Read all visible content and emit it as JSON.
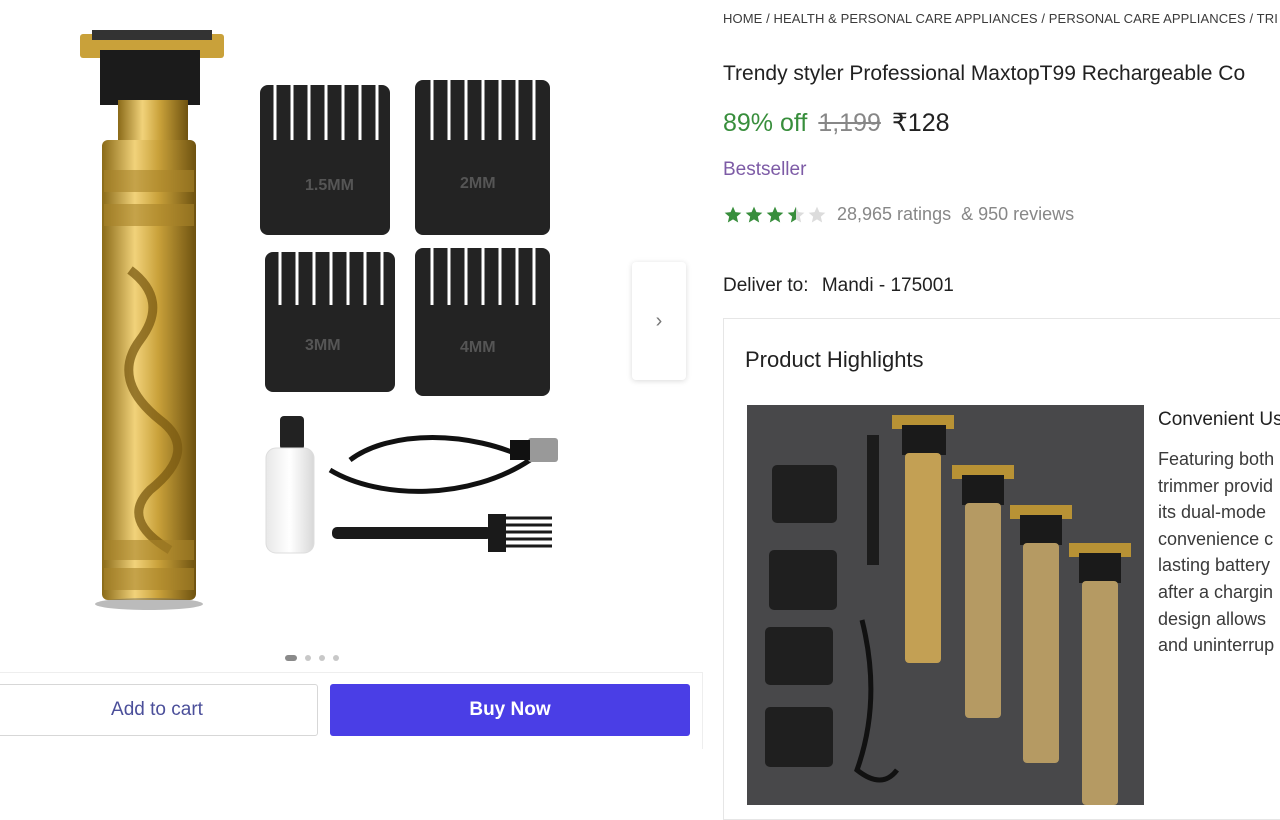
{
  "breadcrumb": "HOME / HEALTH & PERSONAL CARE APPLIANCES / PERSONAL CARE APPLIANCES / TRI",
  "product": {
    "title": "Trendy styler Professional MaxtopT99 Rechargeable Co",
    "discount": "89% off",
    "mrp": "1,199",
    "price": "₹128",
    "badge": "Bestseller",
    "rating": 3.5,
    "ratings_text": "28,965 ratings",
    "reviews_text": "& 950 reviews"
  },
  "delivery": {
    "label": "Deliver to:",
    "location": "Mandi - 175001"
  },
  "highlights": {
    "title": "Product Highlights",
    "subtitle": "Convenient Us",
    "lines": [
      "Featuring both",
      "trimmer provid",
      "its dual-mode",
      "convenience c",
      "lasting battery",
      "after a chargin",
      "design allows",
      "and uninterrup"
    ]
  },
  "gallery": {
    "dots": 4,
    "active_dot": 0,
    "comb_labels": [
      "1.5MM",
      "2MM",
      "3MM",
      "4MM"
    ]
  },
  "actions": {
    "add_to_cart": "Add to cart",
    "buy_now": "Buy Now"
  },
  "colors": {
    "accent": "#4a3ee6",
    "discount": "#388e3c",
    "badge": "#7d5ba6",
    "star": "#388e3c"
  },
  "icons": {
    "next": "chevron-right-icon",
    "star": "star-icon"
  }
}
